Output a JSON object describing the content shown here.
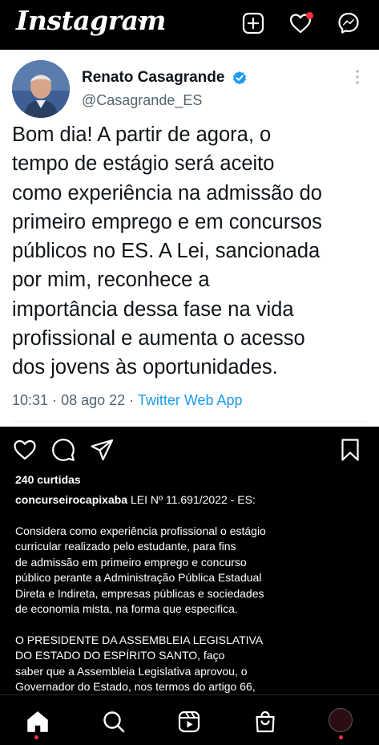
{
  "app": {
    "logo": "Instagram",
    "accent_color": "#ff3040"
  },
  "topbar": {
    "icons": [
      "chevron-down-icon",
      "create-post-icon",
      "heart-icon",
      "messenger-icon"
    ]
  },
  "tweet": {
    "author_name": "Renato Casagrande",
    "handle": "@Casagrande_ES",
    "verified": true,
    "text_lines": [
      "Bom dia! A partir de agora, o",
      "tempo de estágio será aceito",
      "como experiência na admissão do",
      "primeiro emprego e em concursos",
      "públicos no ES. A Lei, sancionada",
      "por mim, reconhece a",
      "importância dessa fase na vida",
      "profissional e aumenta o acesso",
      "dos jovens às oportunidades."
    ],
    "time": "10:31",
    "date": "08 ago 22",
    "source": "Twitter Web App",
    "link_color": "#1d9bf0"
  },
  "post": {
    "likes": "240 curtidas",
    "username": "concurseirocapixaba",
    "caption_first": "LEI Nº 11.691/2022 - ES:",
    "paragraph1": [
      "Considera como experiência profissional o estágio",
      "curricular realizado pelo estudante, para fins",
      "de admissão em primeiro emprego e concurso",
      "público perante a Administração Pública Estadual",
      "Direta e Indireta, empresas públicas e sociedades",
      "de economia mista, na forma que especifica."
    ],
    "paragraph2": [
      "O PRESIDENTE DA ASSEMBLEIA LEGISLATIVA",
      "DO ESTADO DO ESPÍRITO SANTO, faço",
      "saber que a Assembleia Legislativa aprovou, o",
      "Governador do Estado, nos termos do artigo 66,"
    ]
  },
  "bottomnav": {
    "items": [
      "home-icon",
      "search-icon",
      "reels-icon",
      "shop-icon",
      "profile-avatar"
    ]
  }
}
